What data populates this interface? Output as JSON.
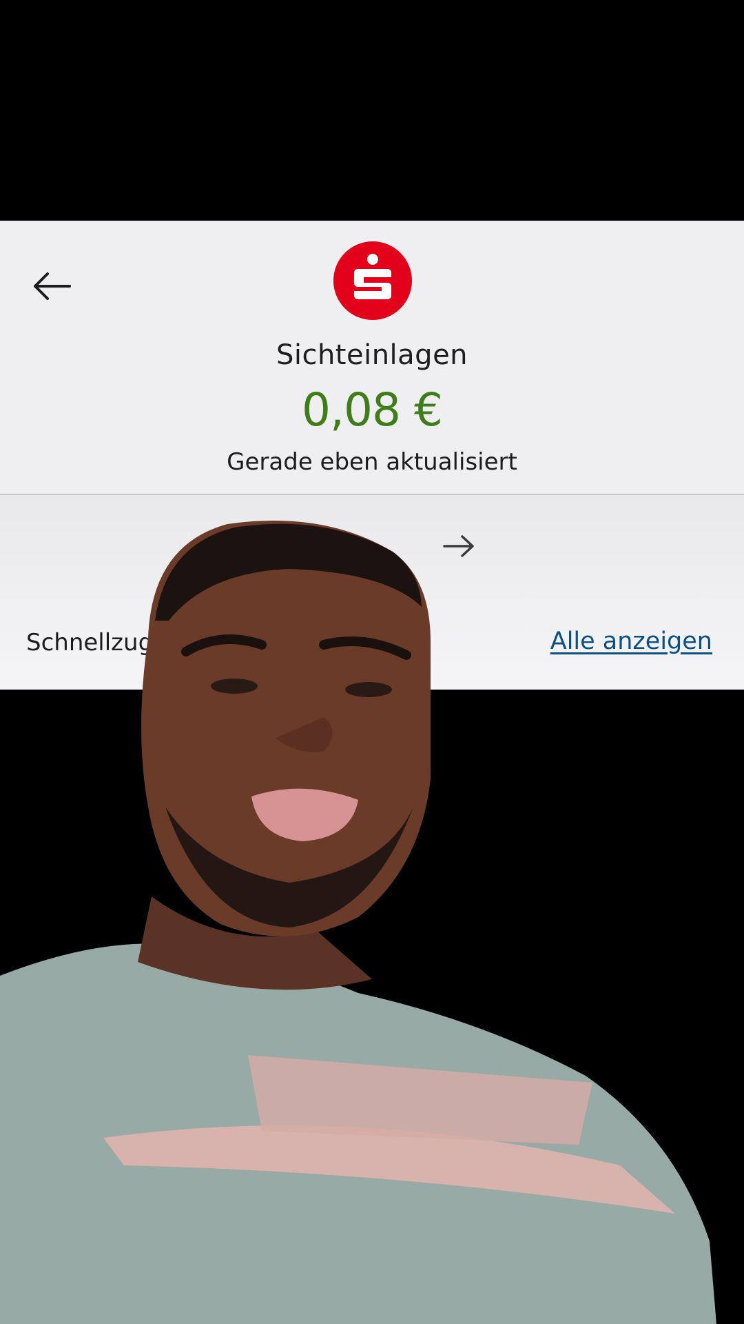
{
  "account": {
    "name": "Sichteinlagen",
    "balance": "0,08 €",
    "update_status": "Gerade eben aktualisiert"
  },
  "icons": {
    "back": "arrow-left-icon",
    "forward": "arrow-right-icon",
    "logo": "sparkasse-logo"
  },
  "quick_access": {
    "label": "Schnellzug",
    "show_all": "Alle anzeigen"
  },
  "colors": {
    "brand_red": "#e2001a",
    "balance_green": "#3f7d1a",
    "link_blue": "#0b4f86",
    "panel_bg": "#efeff1"
  }
}
